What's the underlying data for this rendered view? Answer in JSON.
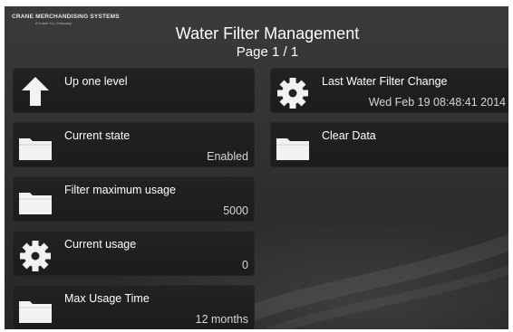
{
  "brand": {
    "name": "CRANE MERCHANDISING SYSTEMS",
    "subtitle": "A Crane Co. Company"
  },
  "header": {
    "title": "Water Filter Management",
    "page": "Page 1 / 1"
  },
  "tiles": [
    {
      "label": "Up one level",
      "value": "",
      "icon": "arrow-up-icon"
    },
    {
      "label": "Current state",
      "value": "Enabled",
      "icon": "folder-icon"
    },
    {
      "label": "Filter maximum usage",
      "value": "5000",
      "icon": "folder-icon"
    },
    {
      "label": "Current usage",
      "value": "0",
      "icon": "gear-icon"
    },
    {
      "label": "Max Usage Time",
      "value": "12 months",
      "icon": "folder-icon"
    },
    {
      "label": "Last Water Filter Change",
      "value": "Wed Feb 19 08:48:41 2014",
      "icon": "gear-icon"
    },
    {
      "label": "Clear Data",
      "value": "",
      "icon": "folder-icon"
    }
  ]
}
